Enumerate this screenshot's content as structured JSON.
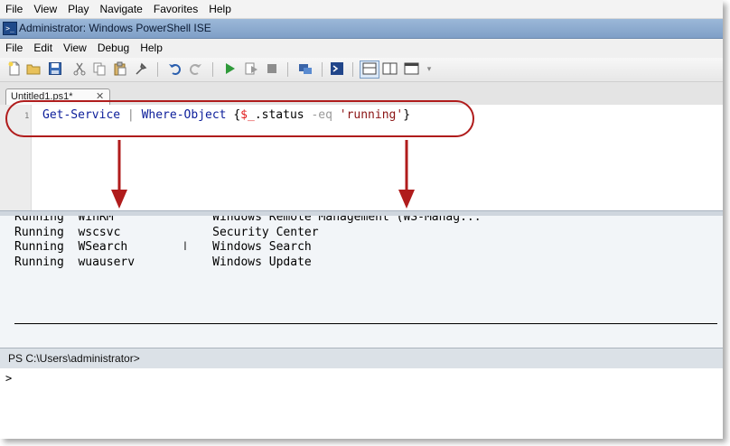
{
  "outer_menu": [
    "File",
    "View",
    "Play",
    "Navigate",
    "Favorites",
    "Help"
  ],
  "window": {
    "title": "Administrator: Windows PowerShell ISE"
  },
  "menu": [
    "File",
    "Edit",
    "View",
    "Debug",
    "Help"
  ],
  "toolbar_icons": [
    "new-icon",
    "open-icon",
    "save-icon",
    "cut-icon",
    "copy-icon",
    "paste-icon",
    "clear-icon",
    "undo-icon",
    "redo-icon",
    "run-icon",
    "run-selection-icon",
    "stop-icon",
    "new-remote-tab-icon",
    "start-powershell-icon",
    "layout-top-icon",
    "layout-right-icon",
    "layout-max-icon"
  ],
  "tab": {
    "label": "Untitled1.ps1*",
    "close": "✕"
  },
  "editor": {
    "line_number": "1",
    "tokens": {
      "cmd1": "Get-Service",
      "pipe": " | ",
      "cmd2": "Where-Object",
      "brace_open": " {",
      "var": "$_",
      "prop": ".status ",
      "op": "-eq",
      "space": " ",
      "str": "'running'",
      "brace_close": "}"
    }
  },
  "output": {
    "text": "Running  WinRM              Windows Remote Management (WS-Manag...\nRunning  wscsvc             Security Center\nRunning  WSearch            Windows Search\nRunning  wuauserv           Windows Update"
  },
  "prompt": {
    "text": "PS C:\\Users\\administrator>"
  },
  "command_pane": {
    "caret": ">"
  },
  "colors": {
    "annotation": "#b01c1c",
    "titlebar": "#8fabd0"
  }
}
